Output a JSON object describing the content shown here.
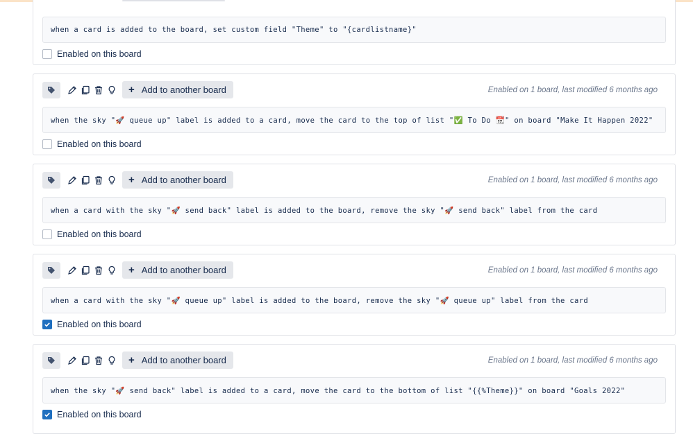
{
  "enabled_label": "Enabled on this board",
  "add_button_label": "Add to another board",
  "partial_rule": {
    "text": "when a card is added to the board, set custom field \"Theme\" to \"{cardlistname}\"",
    "enabled": false
  },
  "rules": [
    {
      "meta": "Enabled on 1 board, last modified 6 months ago",
      "text": "when the sky \"🚀 queue up\" label is added to a card, move the card to the top of list \"✅ To Do 📆\" on board \"Make It Happen 2022\"",
      "enabled": false
    },
    {
      "meta": "Enabled on 1 board, last modified 6 months ago",
      "text": "when a card with the sky \"🚀 send back\" label is added to the board, remove the sky \"🚀 send back\" label from the card",
      "enabled": false
    },
    {
      "meta": "Enabled on 1 board, last modified 6 months ago",
      "text": "when a card with the sky \"🚀 queue up\" label is added to the board, remove the sky \"🚀 queue up\" label from the card",
      "enabled": true
    },
    {
      "meta": "Enabled on 1 board, last modified 6 months ago",
      "text": "when the sky \"🚀 send back\" label is added to a card, move the card to the bottom of list \"{{%Theme}}\" on board \"Goals 2022\"",
      "enabled": true
    }
  ],
  "icons": [
    "tag-icon",
    "edit-icon",
    "copy-icon",
    "trash-icon",
    "lightbulb-icon",
    "plus-icon"
  ],
  "colors": {
    "checkbox_checked": "#1f6fbf",
    "button_bg": "#e5e7eb",
    "meta_text": "#6b778c"
  }
}
